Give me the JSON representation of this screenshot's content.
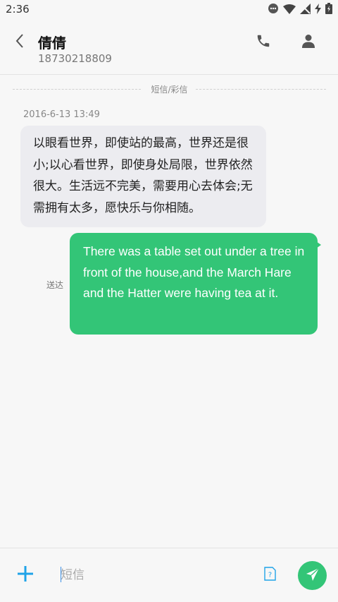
{
  "status_bar": {
    "time": "2:36",
    "icons": [
      "notification-dot-icon",
      "wifi-icon",
      "no-signal-icon",
      "charging-bolt-icon",
      "battery-icon"
    ]
  },
  "header": {
    "contact_name": "倩倩",
    "contact_number": "18730218809",
    "icons": [
      "back-chevron-icon",
      "phone-icon",
      "person-icon"
    ]
  },
  "conversation": {
    "divider_label": "短信/彩信",
    "timestamp": "2016-6-13 13:49",
    "incoming_message": "以眼看世界，即使站的最高，世界还是很小;以心看世界，即使身处局限，世界依然很大。生活远不完美，需要用心去体会;无需拥有太多，愿快乐与你相随。",
    "outgoing_message": "There was a table set out under a tree in front of the house,and the March Hare and the Hatter were having tea at it.",
    "outgoing_status": "送达"
  },
  "compose": {
    "placeholder": "短信",
    "value": "",
    "icons": [
      "add-icon",
      "sim-card-icon",
      "send-icon"
    ]
  },
  "colors": {
    "accent_green": "#33c577",
    "add_blue": "#1fa3e8",
    "background": "#f7f7f7",
    "incoming_bubble": "#ececf0"
  }
}
